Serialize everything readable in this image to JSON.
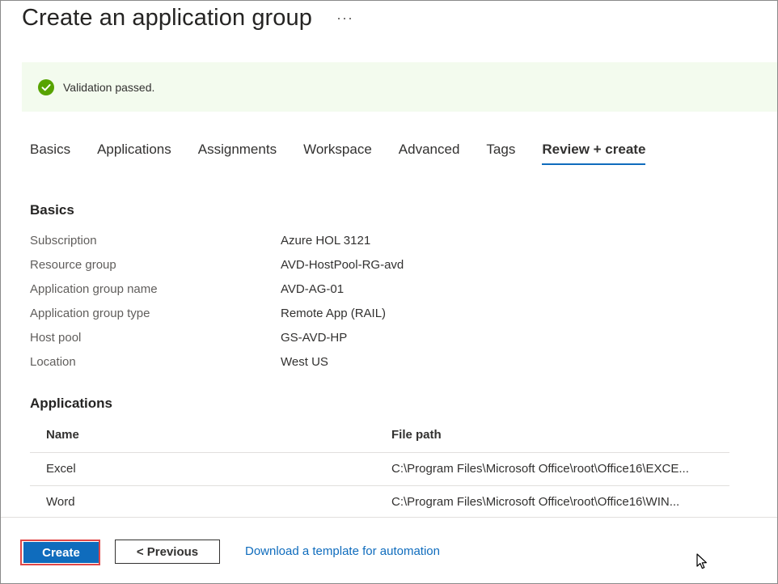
{
  "header": {
    "title": "Create an application group",
    "more_label": "···"
  },
  "banner": {
    "text": "Validation passed.",
    "icon": "check-circle-icon",
    "color": "#57a300"
  },
  "tabs": [
    {
      "label": "Basics",
      "active": false
    },
    {
      "label": "Applications",
      "active": false
    },
    {
      "label": "Assignments",
      "active": false
    },
    {
      "label": "Workspace",
      "active": false
    },
    {
      "label": "Advanced",
      "active": false
    },
    {
      "label": "Tags",
      "active": false
    },
    {
      "label": "Review + create",
      "active": true
    }
  ],
  "basics": {
    "heading": "Basics",
    "rows": [
      {
        "label": "Subscription",
        "value": "Azure HOL 3121"
      },
      {
        "label": "Resource group",
        "value": "AVD-HostPool-RG-avd"
      },
      {
        "label": "Application group name",
        "value": "AVD-AG-01"
      },
      {
        "label": "Application group type",
        "value": "Remote App (RAIL)"
      },
      {
        "label": "Host pool",
        "value": "GS-AVD-HP"
      },
      {
        "label": "Location",
        "value": "West US"
      }
    ]
  },
  "applications": {
    "heading": "Applications",
    "columns": [
      "Name",
      "File path"
    ],
    "rows": [
      {
        "name": "Excel",
        "path": "C:\\Program Files\\Microsoft Office\\root\\Office16\\EXCE..."
      },
      {
        "name": "Word",
        "path": "C:\\Program Files\\Microsoft Office\\root\\Office16\\WIN..."
      }
    ]
  },
  "footer": {
    "create_label": "Create",
    "previous_label": "< Previous",
    "template_link": "Download a template for automation"
  },
  "colors": {
    "accent": "#0f6cbd",
    "highlight_outline": "#e04747",
    "banner_bg": "#f3fbee"
  }
}
